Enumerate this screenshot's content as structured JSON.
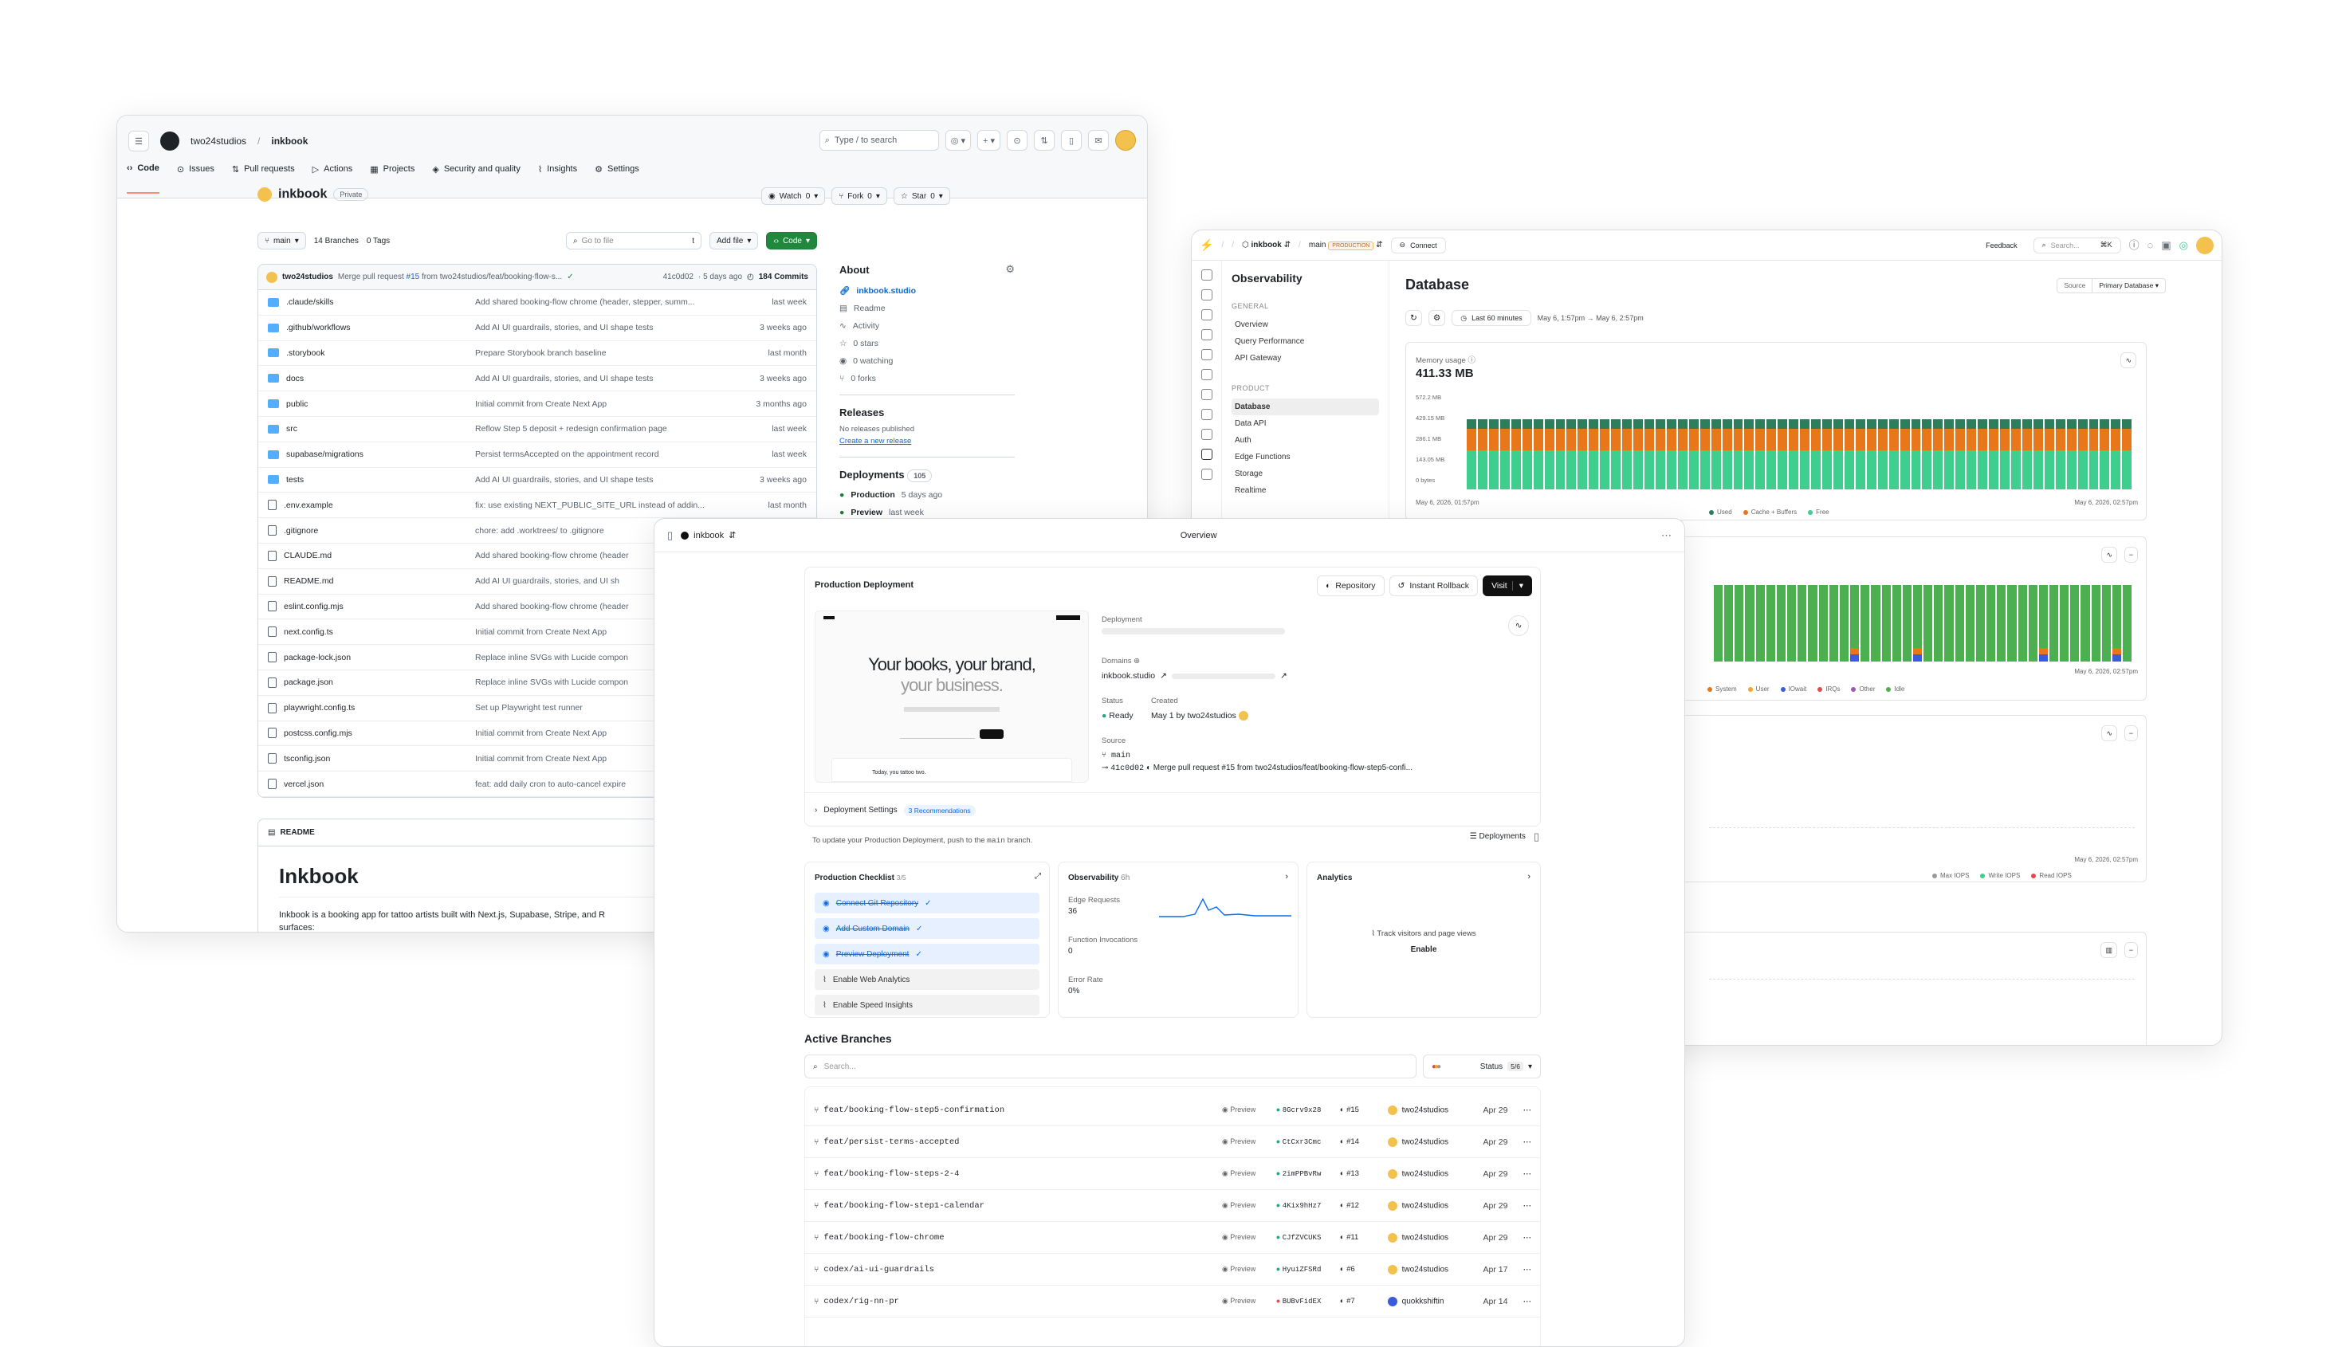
{
  "github": {
    "owner": "two24studios",
    "repo": "inkbook",
    "search_placeholder": "Type / to search",
    "tabs": [
      "Code",
      "Issues",
      "Pull requests",
      "Actions",
      "Projects",
      "Security and quality",
      "Insights",
      "Settings"
    ],
    "visibility": "Private",
    "watch_label": "Watch",
    "watch_count": "0",
    "fork_label": "Fork",
    "fork_count": "0",
    "star_label": "Star",
    "star_count": "0",
    "branch": "main",
    "branches": "14 Branches",
    "tags": "0 Tags",
    "goto_placeholder": "Go to file",
    "goto_key": "t",
    "add_file": "Add file",
    "code_btn": "Code",
    "commit": {
      "author": "two24studios",
      "msg_prefix": "Merge pull request ",
      "msg_link": "#15",
      "msg_suffix": " from two24studios/feat/booking-flow-s...",
      "sha": "41c0d02",
      "ago": "· 5 days ago",
      "commits": "184 Commits"
    },
    "files": [
      {
        "name": ".claude/skills",
        "type": "dir",
        "msg": "Add shared booking-flow chrome (header, stepper, summ...",
        "time": "last week"
      },
      {
        "name": ".github/workflows",
        "type": "dir",
        "msg": "Add AI UI guardrails, stories, and UI shape tests",
        "time": "3 weeks ago"
      },
      {
        "name": ".storybook",
        "type": "dir",
        "msg": "Prepare Storybook branch baseline",
        "time": "last month"
      },
      {
        "name": "docs",
        "type": "dir",
        "msg": "Add AI UI guardrails, stories, and UI shape tests",
        "time": "3 weeks ago"
      },
      {
        "name": "public",
        "type": "dir",
        "msg": "Initial commit from Create Next App",
        "time": "3 months ago"
      },
      {
        "name": "src",
        "type": "dir",
        "msg": "Reflow Step 5 deposit + redesign confirmation page",
        "time": "last week"
      },
      {
        "name": "supabase/migrations",
        "type": "dir",
        "msg": "Persist termsAccepted on the appointment record",
        "time": "last week"
      },
      {
        "name": "tests",
        "type": "dir",
        "msg": "Add AI UI guardrails, stories, and UI shape tests",
        "time": "3 weeks ago"
      },
      {
        "name": ".env.example",
        "type": "file",
        "msg": "fix: use existing NEXT_PUBLIC_SITE_URL instead of addin...",
        "time": "last month"
      },
      {
        "name": ".gitignore",
        "type": "file",
        "msg": "chore: add .worktrees/ to .gitignore",
        "time": ""
      },
      {
        "name": "CLAUDE.md",
        "type": "file",
        "msg": "Add shared booking-flow chrome (header",
        "time": ""
      },
      {
        "name": "README.md",
        "type": "file",
        "msg": "Add AI UI guardrails, stories, and UI sh",
        "time": ""
      },
      {
        "name": "eslint.config.mjs",
        "type": "file",
        "msg": "Add shared booking-flow chrome (header",
        "time": ""
      },
      {
        "name": "next.config.ts",
        "type": "file",
        "msg": "Initial commit from Create Next App",
        "time": ""
      },
      {
        "name": "package-lock.json",
        "type": "file",
        "msg": "Replace inline SVGs with Lucide compon",
        "time": ""
      },
      {
        "name": "package.json",
        "type": "file",
        "msg": "Replace inline SVGs with Lucide compon",
        "time": ""
      },
      {
        "name": "playwright.config.ts",
        "type": "file",
        "msg": "Set up Playwright test runner",
        "time": ""
      },
      {
        "name": "postcss.config.mjs",
        "type": "file",
        "msg": "Initial commit from Create Next App",
        "time": ""
      },
      {
        "name": "tsconfig.json",
        "type": "file",
        "msg": "Initial commit from Create Next App",
        "time": ""
      },
      {
        "name": "vercel.json",
        "type": "file",
        "msg": "feat: add daily cron to auto-cancel expire",
        "time": ""
      }
    ],
    "about": {
      "title": "About",
      "link": "inkbook.studio",
      "items": [
        "Readme",
        "Activity",
        "0 stars",
        "0 watching",
        "0 forks"
      ]
    },
    "releases": {
      "title": "Releases",
      "none": "No releases published",
      "create": "Create a new release"
    },
    "deployments": {
      "title": "Deployments",
      "count": "105",
      "items": [
        {
          "env": "Production",
          "ago": "5 days ago"
        },
        {
          "env": "Preview",
          "ago": "last week"
        }
      ]
    },
    "readme": {
      "tab": "README",
      "h1": "Inkbook",
      "p": "Inkbook is a booking app for tattoo artists built with Next.js, Supabase, Stripe, and R",
      "p2": "surfaces:"
    }
  },
  "supabase": {
    "project": "inkbook",
    "branch": "main",
    "branch_badge": "PRODUCTION",
    "connect": "Connect",
    "feedback": "Feedback",
    "search": "Search...",
    "search_key": "⌘K",
    "menu_title": "Observability",
    "general_hd": "GENERAL",
    "general": [
      "Overview",
      "Query Performance",
      "API Gateway"
    ],
    "product_hd": "PRODUCT",
    "product": [
      "Database",
      "Data API",
      "Auth",
      "Edge Functions",
      "Storage",
      "Realtime"
    ],
    "page_title": "Database",
    "source_label": "Source",
    "source_value": "Primary Database",
    "range_label": "Last 60 minutes",
    "range_value": "May 6, 1:57pm → May 6, 2:57pm",
    "memory": {
      "title": "Memory usage",
      "value": "411.33 MB",
      "ticks": [
        "572.2 MB",
        "429.15 MB",
        "286.1 MB",
        "143.05 MB",
        "0 bytes"
      ],
      "x_start": "May 6, 2026, 01:57pm",
      "x_end": "May 6, 2026, 02:57pm",
      "legend": [
        "Used",
        "Cache + Buffers",
        "Free"
      ]
    },
    "cpu": {
      "x_end": "May 6, 2026, 02:57pm",
      "legend": [
        "System",
        "User",
        "IOwait",
        "IRQs",
        "Other",
        "Idle"
      ]
    },
    "iops": {
      "x_end": "May 6, 2026, 02:57pm",
      "legend": [
        "Max IOPS",
        "Write IOPS",
        "Read IOPS"
      ]
    },
    "colors": {
      "used": "#2e7d5b",
      "cache": "#e8761a",
      "free": "#3ecf8e",
      "idle": "#4caf50"
    }
  },
  "vercel": {
    "project": "inkbook",
    "page": "Overview",
    "prod_title": "Production Deployment",
    "repo_btn": "Repository",
    "rollback_btn": "Instant Rollback",
    "visit_btn": "Visit",
    "preview": {
      "headline": "Your books, your brand,",
      "headline2": "your business.",
      "sub": "Today, you tattoo two."
    },
    "deployment_label": "Deployment",
    "domains_label": "Domains",
    "domain": "inkbook.studio",
    "status_label": "Status",
    "status": "Ready",
    "created_label": "Created",
    "created": "May 1 by two24studios",
    "source_label": "Source",
    "source_branch": "main",
    "source_commit": "41c0d02",
    "source_msg": "Merge pull request #15 from two24studios/feat/booking-flow-step5-confi...",
    "settings_label": "Deployment Settings",
    "recs": "3 Recommendations",
    "update_note_a": "To update your Production Deployment, push to the ",
    "update_note_code": "main",
    "update_note_b": " branch.",
    "deployments_btn": "Deployments",
    "checklist": {
      "title": "Production Checklist",
      "count": "3/5",
      "items": [
        {
          "label": "Connect Git Repository",
          "done": true
        },
        {
          "label": "Add Custom Domain",
          "done": true
        },
        {
          "label": "Preview Deployment",
          "done": true
        },
        {
          "label": "Enable Web Analytics",
          "done": false
        },
        {
          "label": "Enable Speed Insights",
          "done": false
        }
      ]
    },
    "obs": {
      "title": "Observability",
      "period": "6h",
      "edge_label": "Edge Requests",
      "edge": "36",
      "fn_label": "Function Invocations",
      "fn": "0",
      "err_label": "Error Rate",
      "err": "0%"
    },
    "analytics": {
      "title": "Analytics",
      "text": "Track visitors and page views",
      "enable": "Enable"
    },
    "branches_title": "Active Branches",
    "search": "Search...",
    "status_count": "5/6",
    "branches": [
      {
        "name": "feat/booking-flow-step5-confirmation",
        "env": "Preview",
        "sha": "8Gcrv9x28",
        "pr": "#15",
        "user": "two24studios",
        "date": "Apr 29",
        "dot": "#29a383"
      },
      {
        "name": "feat/persist-terms-accepted",
        "env": "Preview",
        "sha": "CtCxr3Cmc",
        "pr": "#14",
        "user": "two24studios",
        "date": "Apr 29",
        "dot": "#29a383"
      },
      {
        "name": "feat/booking-flow-steps-2-4",
        "env": "Preview",
        "sha": "2imPPBvRw",
        "pr": "#13",
        "user": "two24studios",
        "date": "Apr 29",
        "dot": "#29a383"
      },
      {
        "name": "feat/booking-flow-step1-calendar",
        "env": "Preview",
        "sha": "4Kix9hHz7",
        "pr": "#12",
        "user": "two24studios",
        "date": "Apr 29",
        "dot": "#29a383"
      },
      {
        "name": "feat/booking-flow-chrome",
        "env": "Preview",
        "sha": "CJfZVCUKS",
        "pr": "#11",
        "user": "two24studios",
        "date": "Apr 29",
        "dot": "#29a383"
      },
      {
        "name": "codex/ai-ui-guardrails",
        "env": "Preview",
        "sha": "HyuiZFSRd",
        "pr": "#6",
        "user": "two24studios",
        "date": "Apr 17",
        "dot": "#29a383"
      },
      {
        "name": "codex/rig-nn-pr",
        "env": "Preview",
        "sha": "BUBvFidEX",
        "pr": "#7",
        "user": "quokkshiftin",
        "date": "Apr 14",
        "dot": "#e5484d"
      }
    ]
  }
}
